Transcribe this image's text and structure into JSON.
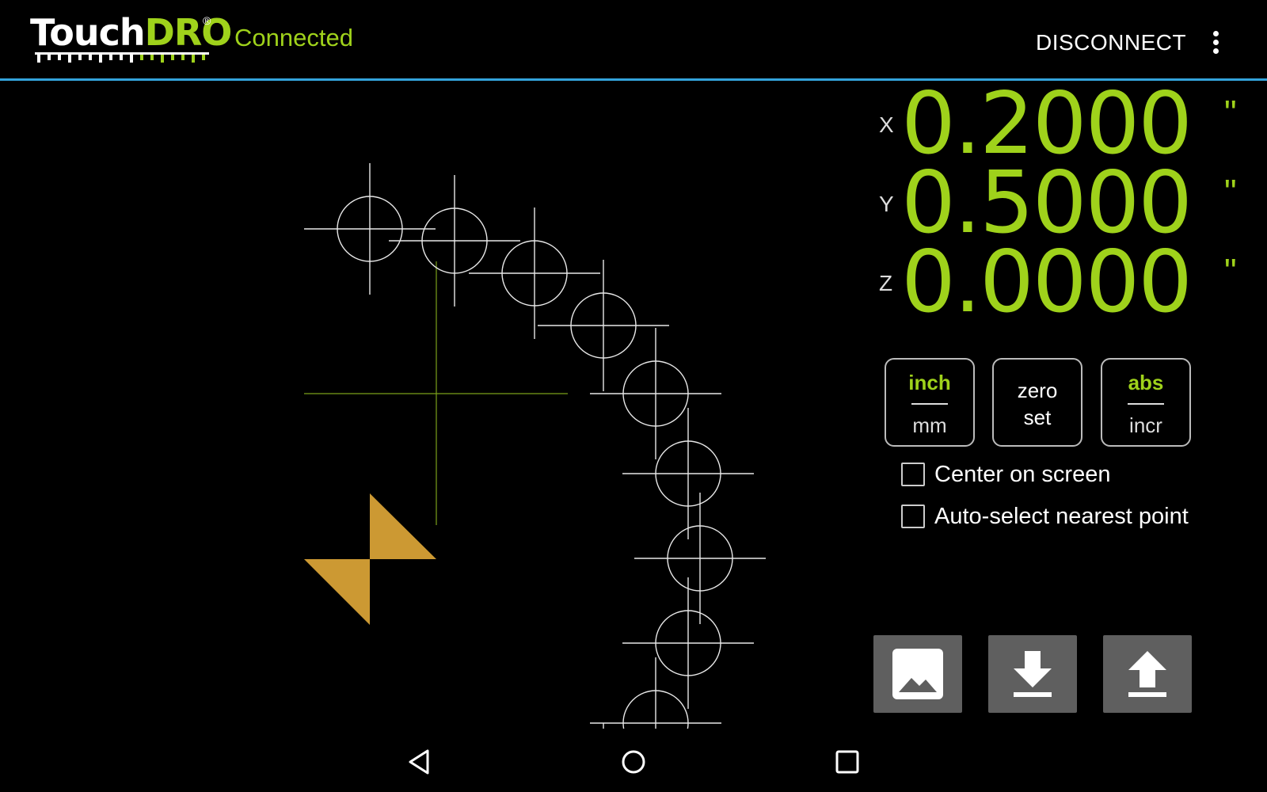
{
  "app": {
    "logo_left": "Touch",
    "logo_right": "DRO",
    "logo_mark": "®",
    "status": "Connected",
    "disconnect_label": "DISCONNECT",
    "menu_icon": "more-vert-icon"
  },
  "readout": {
    "x_label": "X",
    "x_value": "0.2000",
    "x_unit": "\"",
    "y_label": "Y",
    "y_value": "0.5000",
    "y_unit": "\"",
    "z_label": "Z",
    "z_value": "0.0000",
    "z_unit": "\""
  },
  "toggles": {
    "units_active": "inch",
    "units_inactive": "mm",
    "zero_line1": "zero",
    "zero_line2": "set",
    "mode_active": "abs",
    "mode_inactive": "incr"
  },
  "options": {
    "center_label": "Center on screen",
    "center_checked": false,
    "autoselect_label": "Auto-select nearest point",
    "autoselect_checked": false
  },
  "actions": {
    "image_icon": "image-icon",
    "download_icon": "download-icon",
    "upload_icon": "upload-icon"
  },
  "nav": {
    "back_icon": "back-icon",
    "home_icon": "home-icon",
    "recents_icon": "recents-icon"
  },
  "colors": {
    "accent": "#9fd21b",
    "topbar_border": "#33a3dc",
    "marker": "#cc9933",
    "button_gray": "#5f5f5f"
  }
}
